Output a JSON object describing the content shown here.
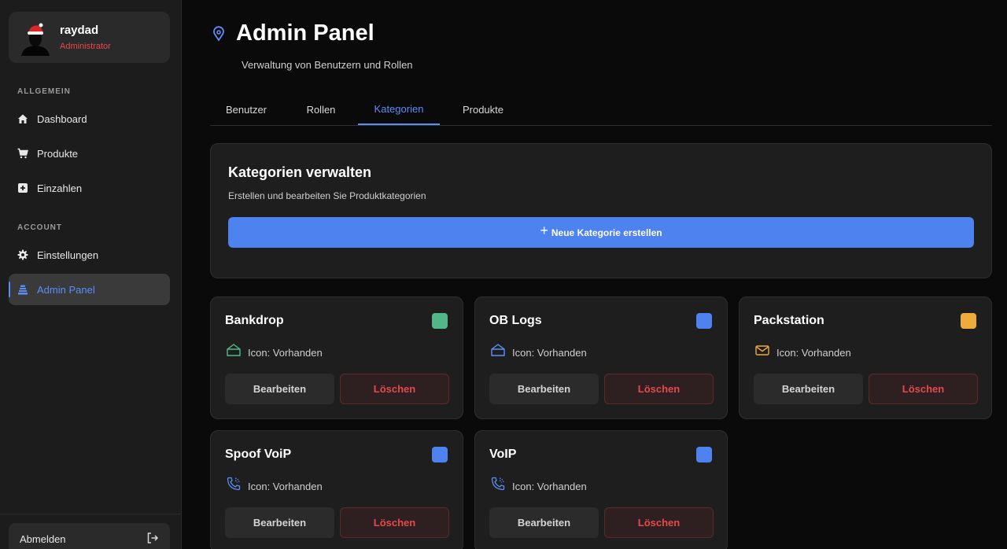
{
  "colors": {
    "accent": "#5b8df6",
    "danger": "#e5484d",
    "green": "#52b788",
    "blue": "#4e82ee",
    "orange": "#f0a93b"
  },
  "user": {
    "name": "raydad",
    "role": "Administrator"
  },
  "sidebar": {
    "section_general": "ALLGEMEIN",
    "section_account": "ACCOUNT",
    "items": [
      {
        "label": "Dashboard",
        "icon": "home-icon"
      },
      {
        "label": "Produkte",
        "icon": "cart-icon"
      },
      {
        "label": "Einzahlen",
        "icon": "plus-square-icon"
      },
      {
        "label": "Einstellungen",
        "icon": "gear-icon"
      },
      {
        "label": "Admin Panel",
        "icon": "admin-icon",
        "active": true
      }
    ],
    "logout_label": "Abmelden"
  },
  "header": {
    "title": "Admin Panel",
    "subtitle": "Verwaltung von Benutzern und Rollen"
  },
  "tabs": [
    {
      "label": "Benutzer"
    },
    {
      "label": "Rollen"
    },
    {
      "label": "Kategorien",
      "active": true
    },
    {
      "label": "Produkte"
    }
  ],
  "manage": {
    "title": "Kategorien verwalten",
    "description": "Erstellen und bearbeiten Sie Produktkategorien",
    "create_label": "Neue Kategorie erstellen"
  },
  "categories": [
    {
      "name": "Bankdrop",
      "color": "#52b788",
      "icon": "inbox-icon",
      "icon_text": "Icon: Vorhanden",
      "edit_label": "Bearbeiten",
      "delete_label": "Löschen"
    },
    {
      "name": "OB Logs",
      "color": "#4e82ee",
      "icon": "inbox-icon",
      "icon_text": "Icon: Vorhanden",
      "edit_label": "Bearbeiten",
      "delete_label": "Löschen"
    },
    {
      "name": "Packstation",
      "color": "#f0a93b",
      "icon": "mail-icon",
      "icon_text": "Icon: Vorhanden",
      "edit_label": "Bearbeiten",
      "delete_label": "Löschen"
    },
    {
      "name": "Spoof VoiP",
      "color": "#4e82ee",
      "icon": "phone-icon",
      "icon_text": "Icon: Vorhanden",
      "edit_label": "Bearbeiten",
      "delete_label": "Löschen"
    },
    {
      "name": "VoIP",
      "color": "#4e82ee",
      "icon": "phone-icon",
      "icon_text": "Icon: Vorhanden",
      "edit_label": "Bearbeiten",
      "delete_label": "Löschen"
    }
  ]
}
